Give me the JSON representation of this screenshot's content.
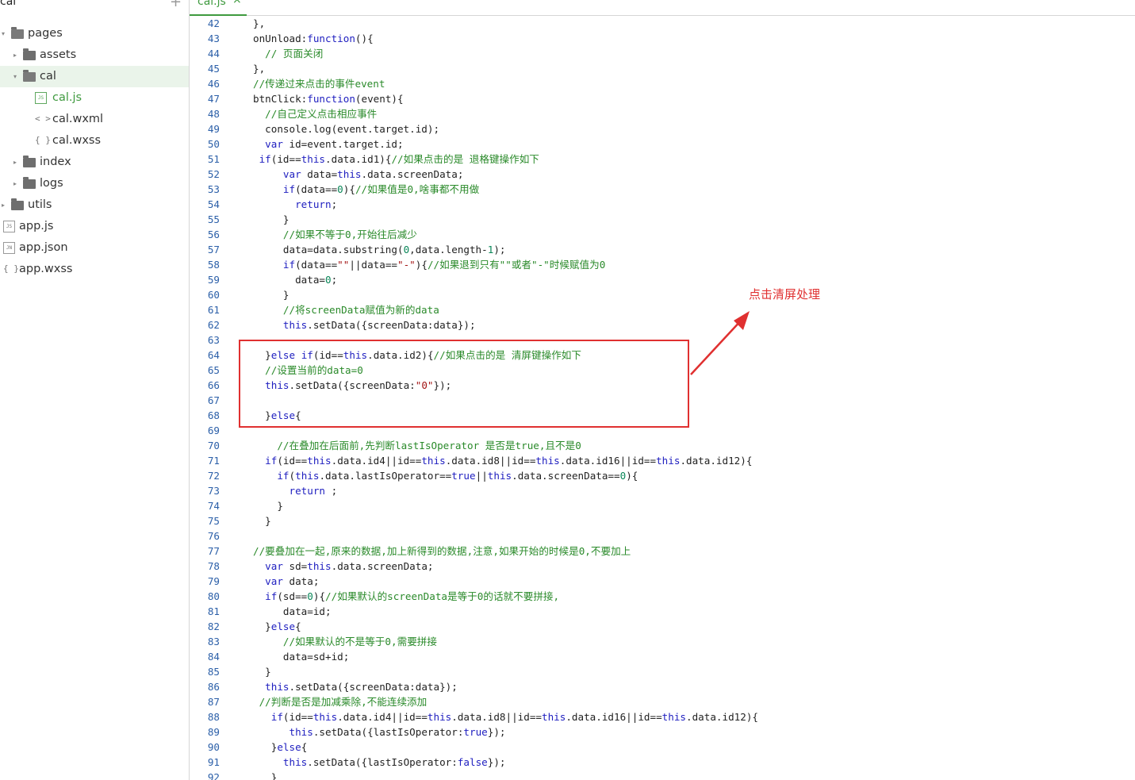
{
  "sidebar": {
    "title": "cal",
    "add_symbol": "+",
    "items": [
      {
        "label": "pages",
        "type": "folder",
        "state": "expanded",
        "level": 0
      },
      {
        "label": "assets",
        "type": "folder",
        "state": "collapsed",
        "level": 1
      },
      {
        "label": "cal",
        "type": "folder",
        "state": "expanded",
        "level": 1,
        "selected": true
      },
      {
        "label": "cal.js",
        "type": "file",
        "icon": "JS",
        "level": 2,
        "active": true
      },
      {
        "label": "cal.wxml",
        "type": "file",
        "icon": "< >",
        "level": 2
      },
      {
        "label": "cal.wxss",
        "type": "file",
        "icon": "{ }",
        "level": 2
      },
      {
        "label": "index",
        "type": "folder",
        "state": "collapsed",
        "level": 1
      },
      {
        "label": "logs",
        "type": "folder",
        "state": "collapsed",
        "level": 1
      },
      {
        "label": "utils",
        "type": "folder",
        "state": "collapsed",
        "level": 0
      },
      {
        "label": "app.js",
        "type": "file",
        "icon": "JS",
        "level": 0
      },
      {
        "label": "app.json",
        "type": "file",
        "icon": "JN",
        "level": 0
      },
      {
        "label": "app.wxss",
        "type": "file",
        "icon": "{ }",
        "level": 0
      }
    ]
  },
  "tab": {
    "label": "cal.js",
    "close": "×"
  },
  "annotation": {
    "text": "点击清屏处理",
    "color": "#e03030"
  },
  "colors": {
    "accent": "#3f9a3f",
    "keyword": "#2020c0",
    "comment": "#2a8a2a",
    "line_number": "#2b5fa8",
    "annotation": "#e03030"
  },
  "code_lines": [
    {
      "n": "42",
      "text": "},"
    },
    {
      "n": "43",
      "text": "onUnload:function(){"
    },
    {
      "n": "44",
      "text": "  // 页面关闭"
    },
    {
      "n": "45",
      "text": "},"
    },
    {
      "n": "46",
      "text": "//传递过来点击的事件event"
    },
    {
      "n": "47",
      "text": "btnClick:function(event){"
    },
    {
      "n": "48",
      "text": "  //自己定义点击相应事件"
    },
    {
      "n": "49",
      "text": "  console.log(event.target.id);"
    },
    {
      "n": "50",
      "text": "  var id=event.target.id;"
    },
    {
      "n": "51",
      "text": " if(id==this.data.id1){//如果点击的是 退格键操作如下"
    },
    {
      "n": "52",
      "text": "     var data=this.data.screenData;"
    },
    {
      "n": "53",
      "text": "     if(data==0){//如果值是0,啥事都不用做"
    },
    {
      "n": "54",
      "text": "       return;"
    },
    {
      "n": "55",
      "text": "     }"
    },
    {
      "n": "56",
      "text": "     //如果不等于0,开始往后减少"
    },
    {
      "n": "57",
      "text": "     data=data.substring(0,data.length-1);"
    },
    {
      "n": "58",
      "text": "     if(data==\"\"||data==\"-\"){//如果退到只有\"\"或者\"-\"时候赋值为0"
    },
    {
      "n": "59",
      "text": "       data=0;"
    },
    {
      "n": "60",
      "text": "     }"
    },
    {
      "n": "61",
      "text": "     //将screenData赋值为新的data"
    },
    {
      "n": "62",
      "text": "     this.setData({screenData:data});"
    },
    {
      "n": "63",
      "text": ""
    },
    {
      "n": "64",
      "text": "  }else if(id==this.data.id2){//如果点击的是 清屏键操作如下"
    },
    {
      "n": "65",
      "text": "  //设置当前的data=0"
    },
    {
      "n": "66",
      "text": "  this.setData({screenData:\"0\"});"
    },
    {
      "n": "67",
      "text": ""
    },
    {
      "n": "68",
      "text": "  }else{"
    },
    {
      "n": "69",
      "text": ""
    },
    {
      "n": "70",
      "text": "    //在叠加在后面前,先判断lastIsOperator 是否是true,且不是0"
    },
    {
      "n": "71",
      "text": "  if(id==this.data.id4||id==this.data.id8||id==this.data.id16||id==this.data.id12){"
    },
    {
      "n": "72",
      "text": "    if(this.data.lastIsOperator==true||this.data.screenData==0){"
    },
    {
      "n": "73",
      "text": "      return ;"
    },
    {
      "n": "74",
      "text": "    }"
    },
    {
      "n": "75",
      "text": "  }"
    },
    {
      "n": "76",
      "text": ""
    },
    {
      "n": "77",
      "text": "//要叠加在一起,原来的数据,加上新得到的数据,注意,如果开始的时候是0,不要加上"
    },
    {
      "n": "78",
      "text": "  var sd=this.data.screenData;"
    },
    {
      "n": "79",
      "text": "  var data;"
    },
    {
      "n": "80",
      "text": "  if(sd==0){//如果默认的screenData是等于0的话就不要拼接,"
    },
    {
      "n": "81",
      "text": "     data=id;"
    },
    {
      "n": "82",
      "text": "  }else{"
    },
    {
      "n": "83",
      "text": "     //如果默认的不是等于0,需要拼接"
    },
    {
      "n": "84",
      "text": "     data=sd+id;"
    },
    {
      "n": "85",
      "text": "  }"
    },
    {
      "n": "86",
      "text": "  this.setData({screenData:data});"
    },
    {
      "n": "87",
      "text": " //判断是否是加减乘除,不能连续添加"
    },
    {
      "n": "88",
      "text": "   if(id==this.data.id4||id==this.data.id8||id==this.data.id16||id==this.data.id12){"
    },
    {
      "n": "89",
      "text": "      this.setData({lastIsOperator:true});"
    },
    {
      "n": "90",
      "text": "   }else{"
    },
    {
      "n": "91",
      "text": "     this.setData({lastIsOperator:false});"
    },
    {
      "n": "92",
      "text": "   }"
    }
  ]
}
